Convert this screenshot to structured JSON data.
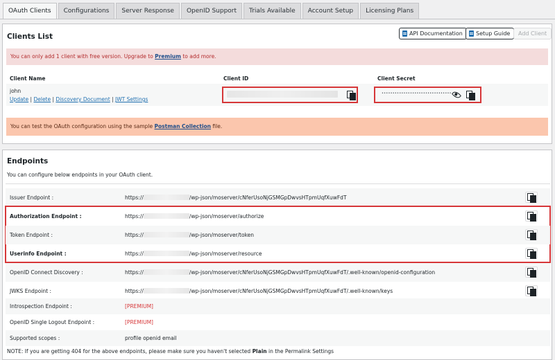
{
  "tabs": [
    {
      "label": "OAuth Clients",
      "active": true
    },
    {
      "label": "Configurations"
    },
    {
      "label": "Server Response"
    },
    {
      "label": "OpenID Support"
    },
    {
      "label": "Trials Available"
    },
    {
      "label": "Account Setup"
    },
    {
      "label": "Licensing Plans"
    }
  ],
  "clients": {
    "title": "Clients List",
    "api_doc_label": "API Documentation",
    "setup_guide_label": "Setup Guide",
    "add_client_label": "Add Client",
    "notice_prefix": "You can only add 1 client with free version. Upgrade to ",
    "notice_link": "Premium",
    "notice_suffix": " to add more.",
    "col_name": "Client Name",
    "col_id": "Client ID",
    "col_secret": "Client Secret",
    "row_name": "john",
    "link_update": "Update",
    "link_delete": "Delete",
    "link_discovery": "Discovery Document",
    "link_jwt": "JWT Settings",
    "link_sep": " | ",
    "secret_mask": "••••••••••••••••••••••••••••••••",
    "postman_prefix": "You can test the OAuth configuration using the sample ",
    "postman_link": "Postman Collection",
    "postman_suffix": " file."
  },
  "endpoints": {
    "title": "Endpoints",
    "intro": "You can configure below endpoints in your OAuth client.",
    "rows": [
      {
        "label": "Issuer Endpoint :",
        "prefix": "https://",
        "suffix": "/wp-json/moserver/cNferUsoNjGSMGpDwvsHTpmUqfXuwFdT",
        "bold": false
      },
      {
        "label": "Authorization Endpoint :",
        "prefix": "https://",
        "suffix": "/wp-json/moserver/authorize",
        "bold": true
      },
      {
        "label": "Token Endpoint :",
        "prefix": "https://",
        "suffix": "/wp-json/moserver/token",
        "bold": false
      },
      {
        "label": "Userinfo Endpoint :",
        "prefix": "https://",
        "suffix": "/wp-json/moserver/resource",
        "bold": true
      },
      {
        "label": "OpenID Connect Discovery :",
        "prefix": "https://",
        "suffix": "/wp-json/moserver/cNferUsoNjGSMGpDwvsHTpmUqfXuwFdT/.well-known/openid-configuration",
        "bold": false
      },
      {
        "label": "JWKS Endpoint :",
        "prefix": "https://",
        "suffix": "/wp-json/moserver/cNferUsoNjGSMGpDwvsHTpmUqfXuwFdT/.well-known/keys",
        "bold": false
      }
    ],
    "introspection_label": "Introspection Endpoint :",
    "introspection_value": "[PREMIUM]",
    "logout_label": "OpenID Single Logout Endpoint :",
    "logout_value": "[PREMIUM]",
    "scopes_label": "Supported scopes :",
    "scopes_value": "profile openid email",
    "note_prefix": "NOTE: If you are getting 404 for the above endpoints, please make sure you haven't selected ",
    "note_plain": "Plain",
    "note_suffix": " in the Permalink Settings"
  }
}
